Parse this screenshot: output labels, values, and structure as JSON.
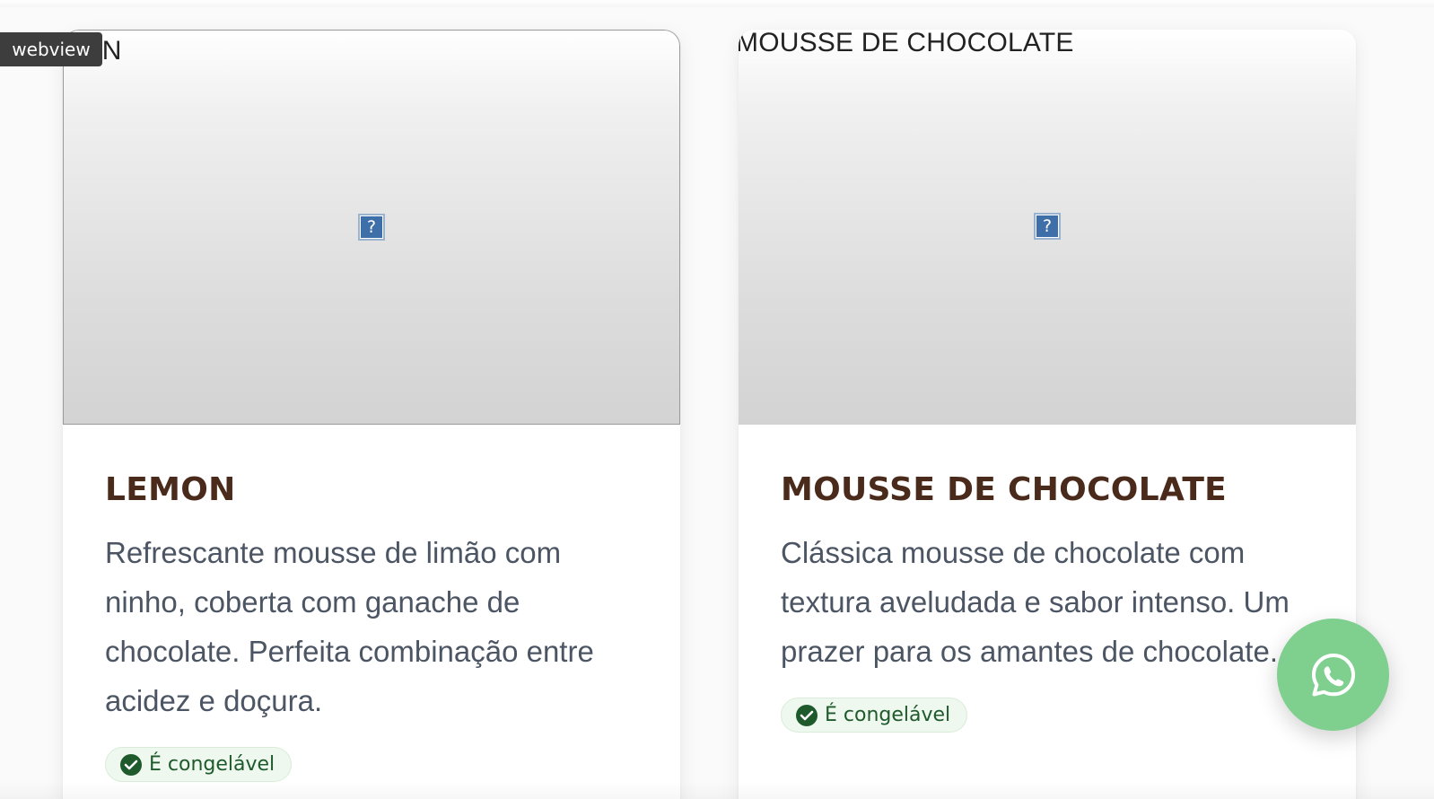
{
  "debug_tag": {
    "label": "webview"
  },
  "products": [
    {
      "image_alt": "LEMON",
      "image_alt_visible": "MON",
      "broken_icon": "?",
      "title": "LEMON",
      "description": "Refrescante mousse de limão com ninho, coberta com ganache de chocolate. Perfeita combinação entre acidez e doçura.",
      "badge": {
        "label": "É congelável",
        "icon": "check-circle-icon"
      }
    },
    {
      "image_alt": "MOUSSE DE CHOCOLATE",
      "image_alt_visible": "MOUSSE DE CHOCOLATE",
      "broken_icon": "?",
      "title": "MOUSSE DE CHOCOLATE",
      "description": "Clássica mousse de chocolate com textura aveludada e sabor intenso. Um prazer para os amantes de chocolate.",
      "badge": {
        "label": "É congelável",
        "icon": "check-circle-icon"
      }
    }
  ],
  "whatsapp": {
    "icon": "whatsapp-icon",
    "color": "#7fcf8e"
  },
  "colors": {
    "title": "#4a2a1a",
    "description": "#4c5563",
    "badge_bg": "#eef8ee",
    "badge_text": "#1f5a2c"
  }
}
